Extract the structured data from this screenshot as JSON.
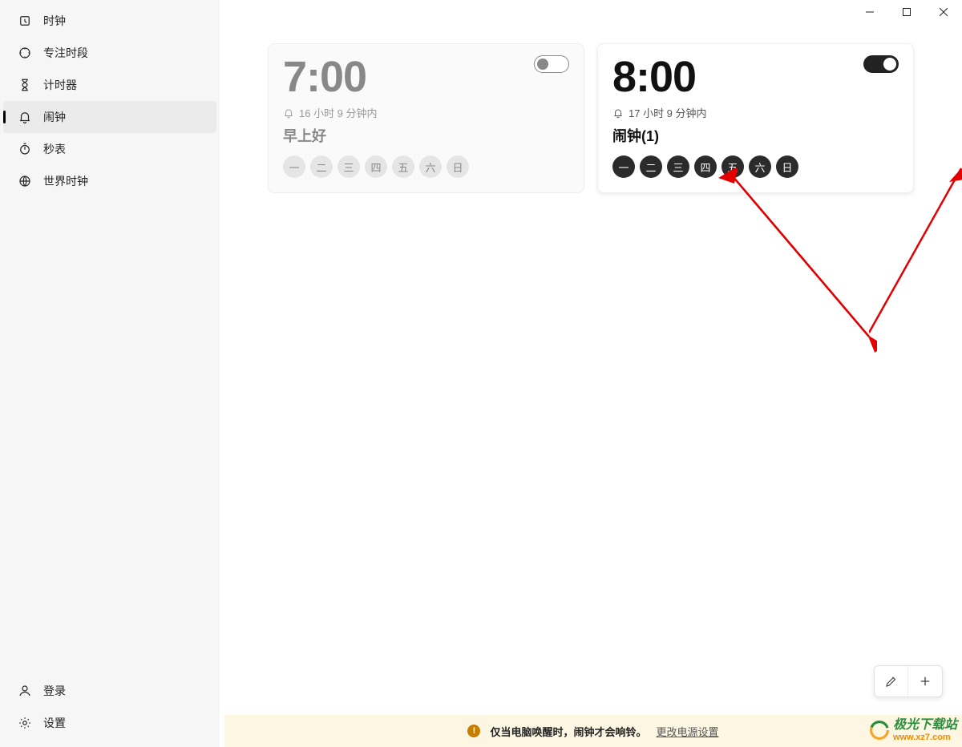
{
  "sidebar": {
    "items": [
      {
        "label": "时钟"
      },
      {
        "label": "专注时段"
      },
      {
        "label": "计时器"
      },
      {
        "label": "闹钟"
      },
      {
        "label": "秒表"
      },
      {
        "label": "世界时钟"
      }
    ],
    "login": "登录",
    "settings": "设置"
  },
  "alarms": [
    {
      "time": "7:00",
      "countdown": "16 小时 9 分钟内",
      "label": "早上好",
      "enabled": false,
      "days": [
        "一",
        "二",
        "三",
        "四",
        "五",
        "六",
        "日"
      ],
      "activeDays": []
    },
    {
      "time": "8:00",
      "countdown": "17 小时 9 分钟内",
      "label": "闹钟(1)",
      "enabled": true,
      "days": [
        "一",
        "二",
        "三",
        "四",
        "五",
        "六",
        "日"
      ],
      "activeDays": [
        "一",
        "二",
        "三",
        "四",
        "五",
        "六",
        "日"
      ]
    }
  ],
  "infobar": {
    "text": "仅当电脑唤醒时，闹钟才会响铃。",
    "link": "更改电源设置"
  },
  "watermark": {
    "title": "极光下载站",
    "url": "www.xz7.com"
  }
}
